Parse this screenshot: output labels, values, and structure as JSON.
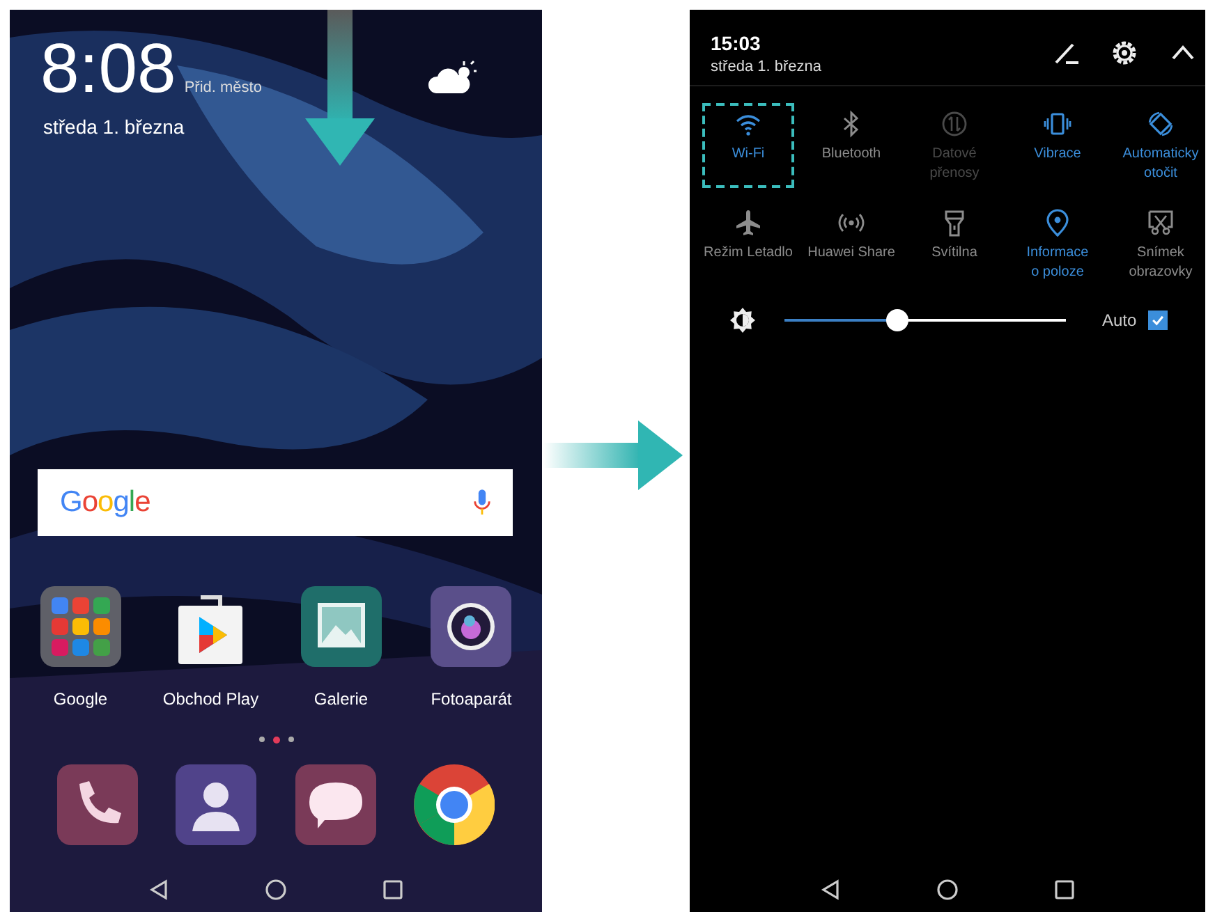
{
  "home_screen": {
    "clock": "8:08",
    "weather_hint": "Přid. město",
    "date": "středa 1. března",
    "search": {
      "logo": "Google"
    },
    "apps": [
      {
        "label": "Google"
      },
      {
        "label": "Obchod Play"
      },
      {
        "label": "Galerie"
      },
      {
        "label": "Fotoaparát"
      }
    ],
    "page_dots": [
      {
        "selected": false
      },
      {
        "selected": true
      },
      {
        "selected": false
      }
    ]
  },
  "quick_settings": {
    "time": "15:03",
    "date": "středa 1. března",
    "toggles": [
      {
        "label": "Wi-Fi",
        "on": true,
        "disabled": false,
        "highlighted": true
      },
      {
        "label": "Bluetooth",
        "on": false,
        "disabled": false,
        "highlighted": false
      },
      {
        "label": "Datové\npřenosy",
        "on": false,
        "disabled": true,
        "highlighted": false
      },
      {
        "label": "Vibrace",
        "on": true,
        "disabled": false,
        "highlighted": false
      },
      {
        "label": "Automaticky\notočit",
        "on": true,
        "disabled": false,
        "highlighted": false
      },
      {
        "label": "Režim Letadlo",
        "on": false,
        "disabled": false,
        "highlighted": false
      },
      {
        "label": "Huawei Share",
        "on": false,
        "disabled": false,
        "highlighted": false
      },
      {
        "label": "Svítilna",
        "on": false,
        "disabled": false,
        "highlighted": false
      },
      {
        "label": "Informace\no poloze",
        "on": true,
        "disabled": false,
        "highlighted": false
      },
      {
        "label": "Snímek\nobrazovky",
        "on": false,
        "disabled": false,
        "highlighted": false
      }
    ],
    "brightness": {
      "level": 0.4
    },
    "auto_brightness": {
      "label": "Auto",
      "checked": true
    }
  }
}
